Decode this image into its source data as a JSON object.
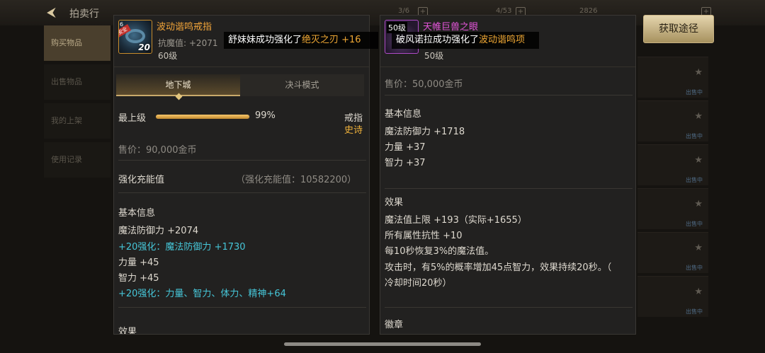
{
  "background": {
    "title": "拍卖行",
    "stats": [
      "3/6",
      "4/53",
      "2826"
    ],
    "side_tabs": [
      "购买物品",
      "出售物品",
      "我的上架",
      "使用记录"
    ],
    "list_tags": [
      "出售中",
      "出售中",
      "出售中",
      "出售中",
      "出售中",
      "出售中"
    ]
  },
  "left_item": {
    "name": "波动谐鸣戒指",
    "icon_level": "20",
    "icon_corner": "6",
    "icon_badge": "安全",
    "anti_magic_label": "抗魔值:",
    "anti_magic_value": "+2071",
    "level": "60级",
    "tabs": [
      "地下城",
      "决斗模式"
    ],
    "top_grade_label": "最上级",
    "top_grade_percent": "99%",
    "top_grade_fraction": 0.99,
    "type_label": "戒指",
    "rarity": "史诗",
    "price": "售价：90,000金币",
    "charge_label": "强化充能值",
    "charge_value": "（强化充能值：10582200）",
    "basic_info_header": "基本信息",
    "stats": [
      {
        "text": "魔法防御力 +2074",
        "color": "white"
      },
      {
        "text": "+20强化：魔法防御力 +1730",
        "color": "cyan"
      },
      {
        "text": "力量 +45",
        "color": "white"
      },
      {
        "text": "智力 +45",
        "color": "white"
      },
      {
        "text": "+20强化：力量、智力、体力、精神+64",
        "color": "cyan"
      }
    ],
    "effect_header": "效果"
  },
  "right_item": {
    "name": "天帷巨兽之眼",
    "icon_level": "50级",
    "level": "50级",
    "price": "售价：50,000金币",
    "basic_info_header": "基本信息",
    "stats": [
      "魔法防御力 +1718",
      "力量 +37",
      "智力 +37"
    ],
    "effect_header": "效果",
    "effects": [
      "魔法值上限 +193（实际+1655）",
      "所有属性抗性 +10",
      "每10秒恢复3%的魔法值。",
      "攻击时，有5%的概率增加45点智力，效果持续20秒。（",
      "冷却时间20秒）"
    ],
    "emblem_header": "徽章"
  },
  "notices": [
    {
      "prefix": "舒妹妹成功强化了",
      "highlight": "绝灭之刃 +16"
    },
    {
      "prefix": "破风诺拉成功强化了",
      "highlight": "波动谐鸣项"
    }
  ],
  "acquire_button": "获取途径",
  "colors": {
    "gold": "#f0b23b",
    "cyan": "#46c6d8",
    "epic_orange": "#f2a53a",
    "purple_name": "#e255d8"
  }
}
